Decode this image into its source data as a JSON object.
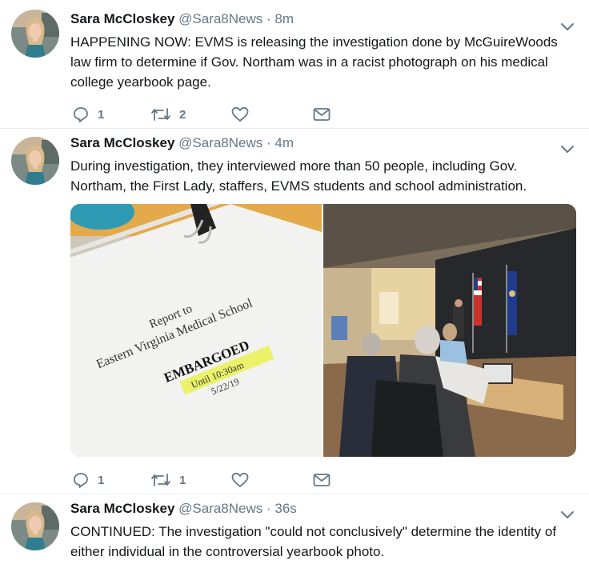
{
  "tweets": [
    {
      "author_name": "Sara McCloskey",
      "handle": "@Sara8News",
      "time": "· 8m",
      "text": "HAPPENING NOW: EVMS is releasing the investigation done by McGuireWoods law firm to determine if Gov. Northam was in a racist photograph on his medical college yearbook page.",
      "reply_count": "1",
      "retweet_count": "2"
    },
    {
      "author_name": "Sara McCloskey",
      "handle": "@Sara8News",
      "time": "· 4m",
      "text": "During investigation, they interviewed more than 50 people, including Gov. Northam, the First Lady, staffers, EVMS students and school administration.",
      "reply_count": "1",
      "retweet_count": "1",
      "photo1": {
        "line1": "Report to",
        "line2": "Eastern Virginia Medical School",
        "stamp": "EMBARGOED",
        "until": "Until 10:30am",
        "date": "5/22/19"
      }
    },
    {
      "author_name": "Sara McCloskey",
      "handle": "@Sara8News",
      "time": "· 36s",
      "text": "CONTINUED: The investigation \"could not conclusively\" determine the identity of either individual in the controversial yearbook photo."
    }
  ],
  "colors": {
    "thread_line": "#a6d3f2",
    "icon_gray": "#657786",
    "separator": "#e6ecf0"
  },
  "icons": [
    "reply-icon",
    "retweet-icon",
    "like-icon",
    "dm-icon",
    "caret-down-icon"
  ]
}
